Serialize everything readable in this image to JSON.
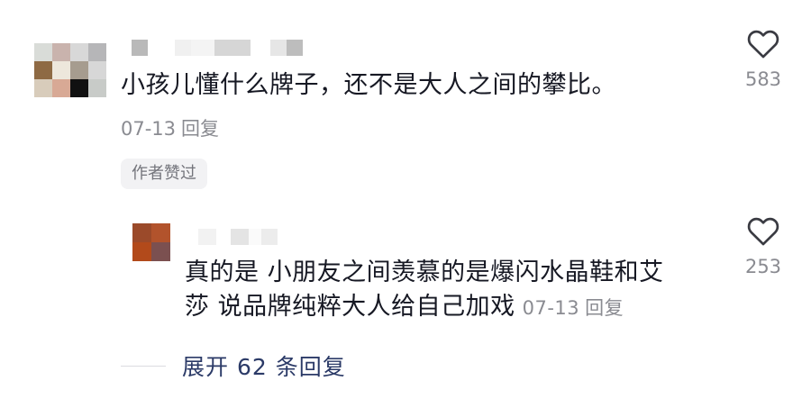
{
  "comment": {
    "text": "小孩儿懂什么牌子，还不是大人之间的攀比。",
    "date": "07-13",
    "reply_label": "回复",
    "likes": "583",
    "author_liked_badge": "作者赞过",
    "avatar_colors": [
      "#d9dcd8",
      "#c9b3ad",
      "#d8d8d8",
      "#b6b6b8",
      "#8e6a44",
      "#ede7dc",
      "#a69c8f",
      "#d7d7d7",
      "#d8ccbb",
      "#d8a995",
      "#111111",
      "#c8cbc8"
    ]
  },
  "reply": {
    "text_line1": "真的是 小朋友之间羡慕的是爆闪水晶鞋和艾",
    "text_line2": "莎 说品牌纯粹大人给自己加戏",
    "date": "07-13",
    "reply_label": "回复",
    "likes": "253",
    "avatar_colors": [
      "#9b4a2a",
      "#b2532c",
      "#b24a1b",
      "#7b5050"
    ]
  },
  "expand": {
    "label": "展开 62 条回复"
  },
  "icons": {
    "like": "heart-outline-icon"
  }
}
